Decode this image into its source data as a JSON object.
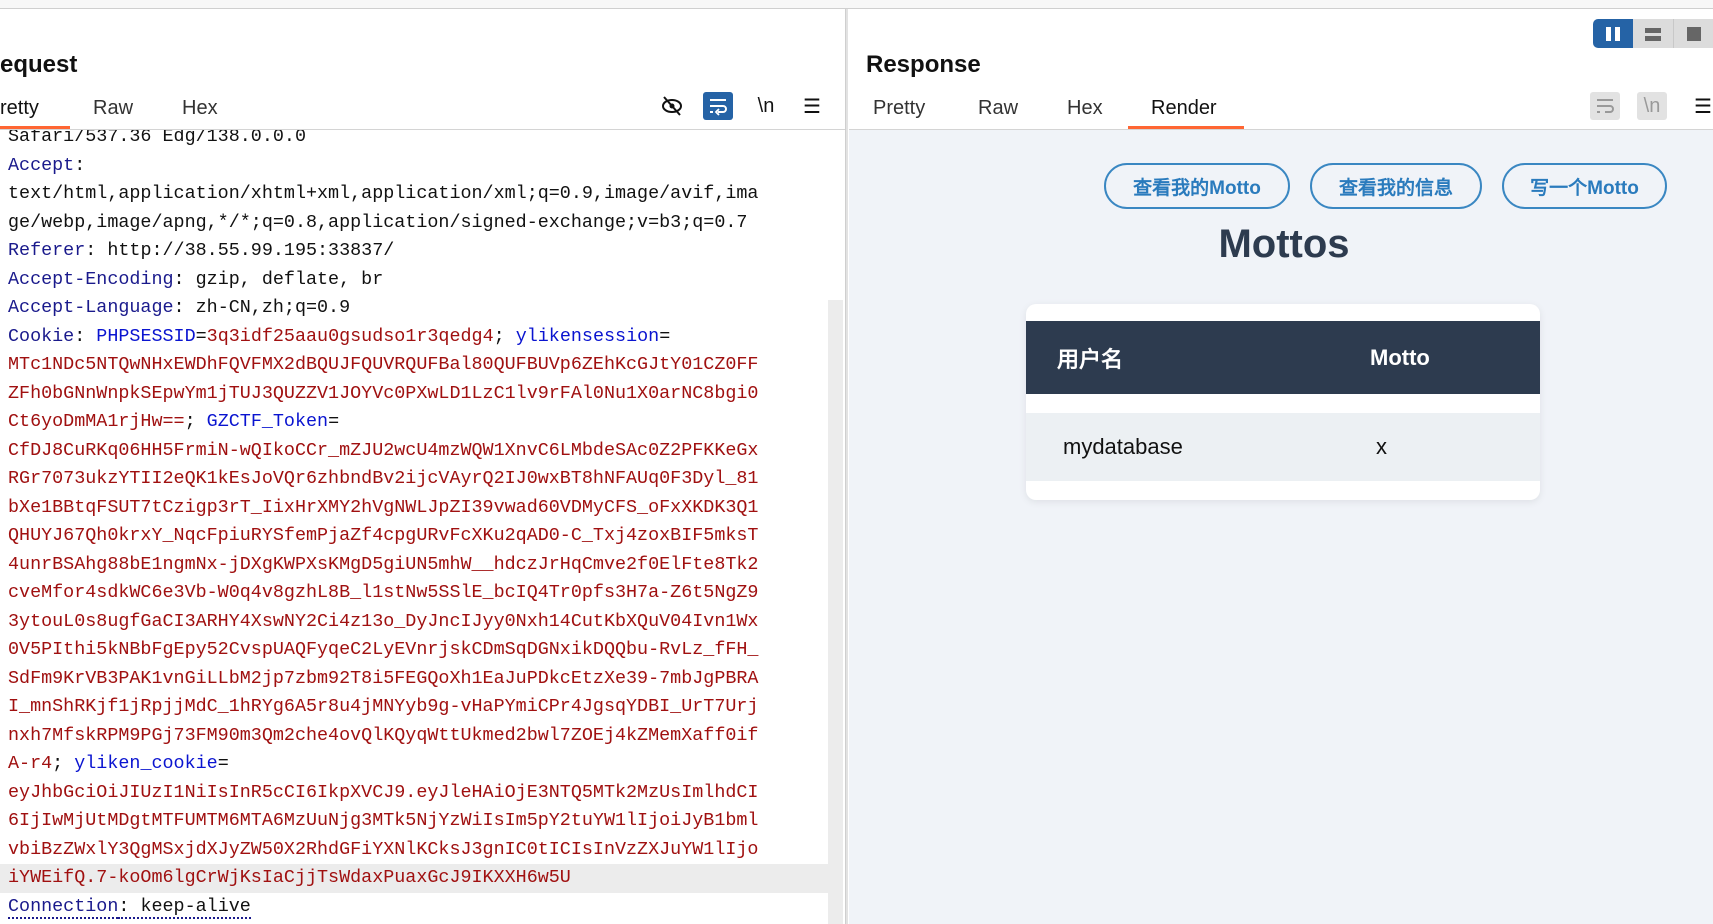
{
  "request": {
    "title": "equest",
    "tabs": [
      {
        "label": "retty",
        "active": true
      },
      {
        "label": "Raw"
      },
      {
        "label": "Hex"
      }
    ],
    "toolbar_icons": [
      "eye-slash-icon",
      "wrap-lines-icon",
      "newline-icon",
      "menu-icon"
    ],
    "newline_label": "\\n",
    "lines": [
      [
        [
          "t",
          "Safari/537.36 Edg/138.0.0.0"
        ]
      ],
      [
        [
          "k",
          "Accept"
        ],
        [
          "t",
          ":"
        ]
      ],
      [
        [
          "t",
          "text/html,application/xhtml+xml,application/xml;q=0.9,image/avif,ima"
        ]
      ],
      [
        [
          "t",
          "ge/webp,image/apng,*/*;q=0.8,application/signed-exchange;v=b3;q=0.7"
        ]
      ],
      [
        [
          "k",
          "Referer"
        ],
        [
          "t",
          ": http://38.55.99.195:33837/"
        ]
      ],
      [
        [
          "k",
          "Accept-Encoding"
        ],
        [
          "t",
          ": gzip, deflate, br"
        ]
      ],
      [
        [
          "k",
          "Accept-Language"
        ],
        [
          "t",
          ": zh-CN,zh;q=0.9"
        ]
      ],
      [
        [
          "k",
          "Cookie"
        ],
        [
          "t",
          ": "
        ],
        [
          "n",
          "PHPSESSID"
        ],
        [
          "t",
          "="
        ],
        [
          "v",
          "3q3idf25aau0gsudso1r3qedg4"
        ],
        [
          "t",
          "; "
        ],
        [
          "n",
          "ylikensession"
        ],
        [
          "t",
          "="
        ]
      ],
      [
        [
          "v",
          "MTc1NDc5NTQwNHxEWDhFQVFMX2dBQUJFQUVRQUFBal80QUFBUVp6ZEhKcGJtY01CZ0FF"
        ]
      ],
      [
        [
          "v",
          "ZFh0bGNnWnpkSEpwYm1jTUJ3QUZZV1JOYVc0PXwLD1LzC1lv9rFAl0Nu1X0arNC8bgi0"
        ]
      ],
      [
        [
          "v",
          "Ct6yoDmMA1rjHw=="
        ],
        [
          "t",
          "; "
        ],
        [
          "n",
          "GZCTF_Token"
        ],
        [
          "t",
          "="
        ]
      ],
      [
        [
          "v",
          "CfDJ8CuRKq06HH5FrmiN-wQIkoCCr_mZJU2wcU4mzWQW1XnvC6LMbdeSAc0Z2PFKKeGx"
        ]
      ],
      [
        [
          "v",
          "RGr7073ukzYTII2eQK1kEsJoVQr6zhbndBv2ijcVAyrQ2IJ0wxBT8hNFAUq0F3Dyl_81"
        ]
      ],
      [
        [
          "v",
          "bXe1BBtqFSUT7tCzigp3rT_IixHrXMY2hVgNWLJpZI39vwad60VDMyCFS_oFxXKDK3Q1"
        ]
      ],
      [
        [
          "v",
          "QHUYJ67Qh0krxY_NqcFpiuRYSfemPjaZf4cpgURvFcXKu2qAD0-C_Txj4zoxBIF5mksT"
        ]
      ],
      [
        [
          "v",
          "4unrBSAhg88bE1ngmNx-jDXgKWPXsKMgD5giUN5mhW__hdczJrHqCmve2f0ElFte8Tk2"
        ]
      ],
      [
        [
          "v",
          "cveMfor4sdkWC6e3Vb-W0q4v8gzhL8B_l1stNw5SSlE_bcIQ4Tr0pfs3H7a-Z6t5NgZ9"
        ]
      ],
      [
        [
          "v",
          "3ytouL0s8ugfGaCI3ARHY4XswNY2Ci4z13o_DyJncIJyy0Nxh14CutKbXQuV04Ivn1Wx"
        ]
      ],
      [
        [
          "v",
          "0V5PIthi5kNBbFgEpy52CvspUAQFyqeC2LyEVnrjskCDmSqDGNxikDQQbu-RvLz_fFH_"
        ]
      ],
      [
        [
          "v",
          "SdFm9KrVB3PAK1vnGiLLbM2jp7zbm92T8i5FEGQoXh1EaJuPDkcEtzXe39-7mbJgPBRA"
        ]
      ],
      [
        [
          "v",
          "I_mnShRKjf1jRpjjMdC_1hRYg6A5r8u4jMNYyb9g-vHaPYmiCPr4JgsqYDBI_UrT7Urj"
        ]
      ],
      [
        [
          "v",
          "nxh7MfskRPM9PGj73FM90m3Qm2che4ovQlKQyqWttUkmed2bwl7ZOEj4kZMemXaff0if"
        ]
      ],
      [
        [
          "v",
          "A-r4"
        ],
        [
          "t",
          "; "
        ],
        [
          "n",
          "yliken_cookie"
        ],
        [
          "t",
          "="
        ]
      ],
      [
        [
          "v",
          "eyJhbGciOiJIUzI1NiIsInR5cCI6IkpXVCJ9.eyJleHAiOjE3NTQ5MTk2MzUsImlhdCI"
        ]
      ],
      [
        [
          "v",
          "6IjIwMjUtMDgtMTFUMTM6MTA6MzUuNjg3MTk5NjYzWiIsIm5pY2tuYW1lIjoiJyB1bml"
        ]
      ],
      [
        [
          "v",
          "vbiBzZWxlY3QgMSxjdXJyZW50X2RhdGFiYXNlKCksJ3gnIC0tICIsInVzZXJuYW1lIjo"
        ]
      ],
      [
        [
          "v",
          "iYWEifQ.7-koOm6lgCrWjKsIaCjjTsWdaxPuaxGcJ9IKXXH6w5U"
        ]
      ],
      [
        [
          "k",
          "Connection"
        ],
        [
          "t",
          ": keep-alive"
        ]
      ]
    ],
    "highlighted_line": 26
  },
  "response": {
    "title": "Response",
    "tabs": [
      {
        "label": "Pretty"
      },
      {
        "label": "Raw"
      },
      {
        "label": "Hex"
      },
      {
        "label": "Render",
        "active": true
      }
    ],
    "newline_label": "\\n",
    "render": {
      "buttons": [
        "查看我的Motto",
        "查看我的信息",
        "写一个Motto"
      ],
      "heading": "Mottos",
      "table": {
        "headers": [
          "用户名",
          "Motto"
        ],
        "rows": [
          [
            "mydatabase",
            "x"
          ]
        ]
      }
    }
  },
  "layout_buttons": [
    "split-horizontal-icon",
    "split-vertical-icon",
    "single-pane-icon"
  ],
  "colors": {
    "accent": "#ff6633",
    "active_icon": "#2563a6",
    "table_header": "#2d3b4f",
    "button": "#3a87c2",
    "render_bg": "#f0f3f8"
  }
}
